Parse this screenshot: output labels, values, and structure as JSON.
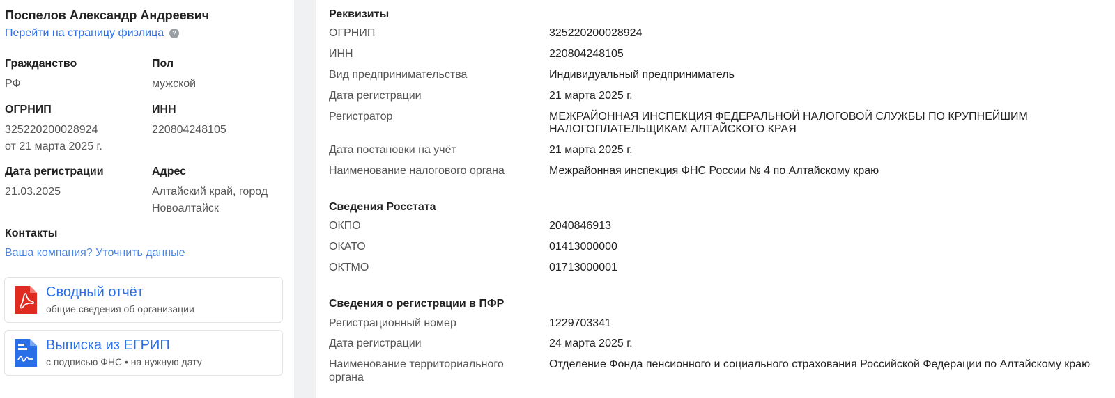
{
  "profile": {
    "name": "Поспелов Александр Андреевич",
    "person_link": "Перейти на страницу физлица",
    "help_glyph": "?"
  },
  "facts": {
    "citizenship_label": "Гражданство",
    "citizenship_value": "РФ",
    "sex_label": "Пол",
    "sex_value": "мужской",
    "ogrnip_label": "ОГРНИП",
    "ogrnip_value": "325220200028924",
    "ogrnip_date": "от 21 марта 2025 г.",
    "inn_label": "ИНН",
    "inn_value": "220804248105",
    "regdate_label": "Дата регистрации",
    "regdate_value": "21.03.2025",
    "address_label": "Адрес",
    "address_line1": "Алтайский край, город",
    "address_line2": "Новоалтайск"
  },
  "contacts": {
    "title": "Контакты",
    "link": "Ваша компания? Уточнить данные"
  },
  "documents": [
    {
      "title": "Сводный отчёт",
      "subtitle": "общие сведения об организации",
      "icon": "pdf-icon",
      "color": "#e02b20"
    },
    {
      "title": "Выписка из ЕГРИП",
      "subtitle": "с подписью ФНС • на нужную дату",
      "icon": "document-icon",
      "color": "#2a6ee8"
    }
  ],
  "requisites": {
    "title": "Реквизиты",
    "rows": [
      {
        "label": "ОГРНИП",
        "value": "325220200028924"
      },
      {
        "label": "ИНН",
        "value": "220804248105"
      },
      {
        "label": "Вид предпринимательства",
        "value": "Индивидуальный предприниматель"
      },
      {
        "label": "Дата регистрации",
        "value": "21 марта 2025 г."
      },
      {
        "label": "Регистратор",
        "value_line1": "МЕЖРАЙОННАЯ ИНСПЕКЦИЯ ФЕДЕРАЛЬНОЙ НАЛОГОВОЙ СЛУЖБЫ ПО КРУПНЕЙШИМ",
        "value_line2": "НАЛОГОПЛАТЕЛЬЩИКАМ АЛТАЙСКОГО КРАЯ"
      },
      {
        "label": "Дата постановки на учёт",
        "value": "21 марта 2025 г."
      },
      {
        "label": "Наименование налогового органа",
        "value": "Межрайонная инспекция ФНС России № 4 по Алтайскому краю"
      }
    ]
  },
  "rosstat": {
    "title": "Сведения Росстата",
    "rows": [
      {
        "label": "ОКПО",
        "value": "2040846913"
      },
      {
        "label": "ОКАТО",
        "value": "01413000000"
      },
      {
        "label": "ОКТМО",
        "value": "01713000001"
      }
    ]
  },
  "pfr": {
    "title": "Сведения о регистрации в ПФР",
    "rows": [
      {
        "label": "Регистрационный номер",
        "value": "1229703341"
      },
      {
        "label": "Дата регистрации",
        "value": "24 марта 2025 г."
      },
      {
        "label_line1": "Наименование территориального",
        "label_line2": "органа",
        "value": "Отделение Фонда пенсионного и социального страхования Российской Федерации по Алтайскому краю"
      }
    ]
  }
}
